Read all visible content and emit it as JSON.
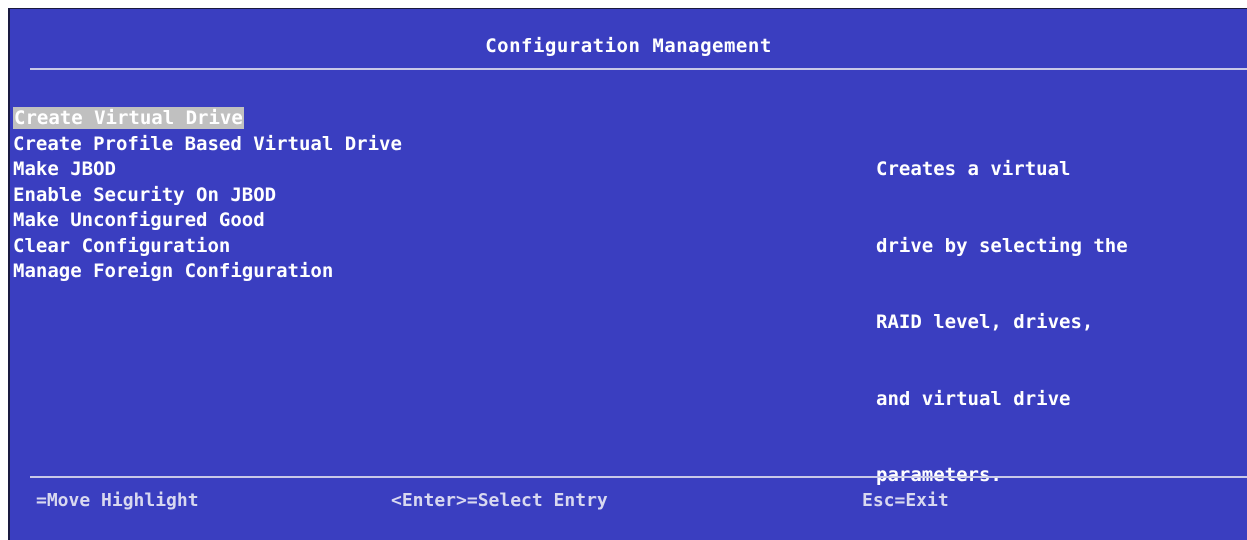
{
  "title": "Configuration Management",
  "menu": {
    "items": [
      {
        "label": "Create Virtual Drive",
        "selected": true
      },
      {
        "label": "Create Profile Based Virtual Drive",
        "selected": false
      },
      {
        "label": "Make JBOD",
        "selected": false
      },
      {
        "label": "Enable Security On JBOD",
        "selected": false
      },
      {
        "label": "Make Unconfigured Good",
        "selected": false
      },
      {
        "label": "Clear Configuration",
        "selected": false
      },
      {
        "label": "Manage Foreign Configuration",
        "selected": false
      }
    ]
  },
  "help": {
    "lines": [
      "Creates a virtual",
      "drive by selecting the",
      "RAID level, drives,",
      "and virtual drive",
      "parameters."
    ]
  },
  "footer": {
    "move": "=Move Highlight",
    "select": "<Enter>=Select Entry",
    "exit": "Esc=Exit"
  },
  "colors": {
    "background": "#3a3ec0",
    "text": "#ffffff",
    "highlight": "#c0c0c0",
    "rule": "#c8c8e8"
  }
}
